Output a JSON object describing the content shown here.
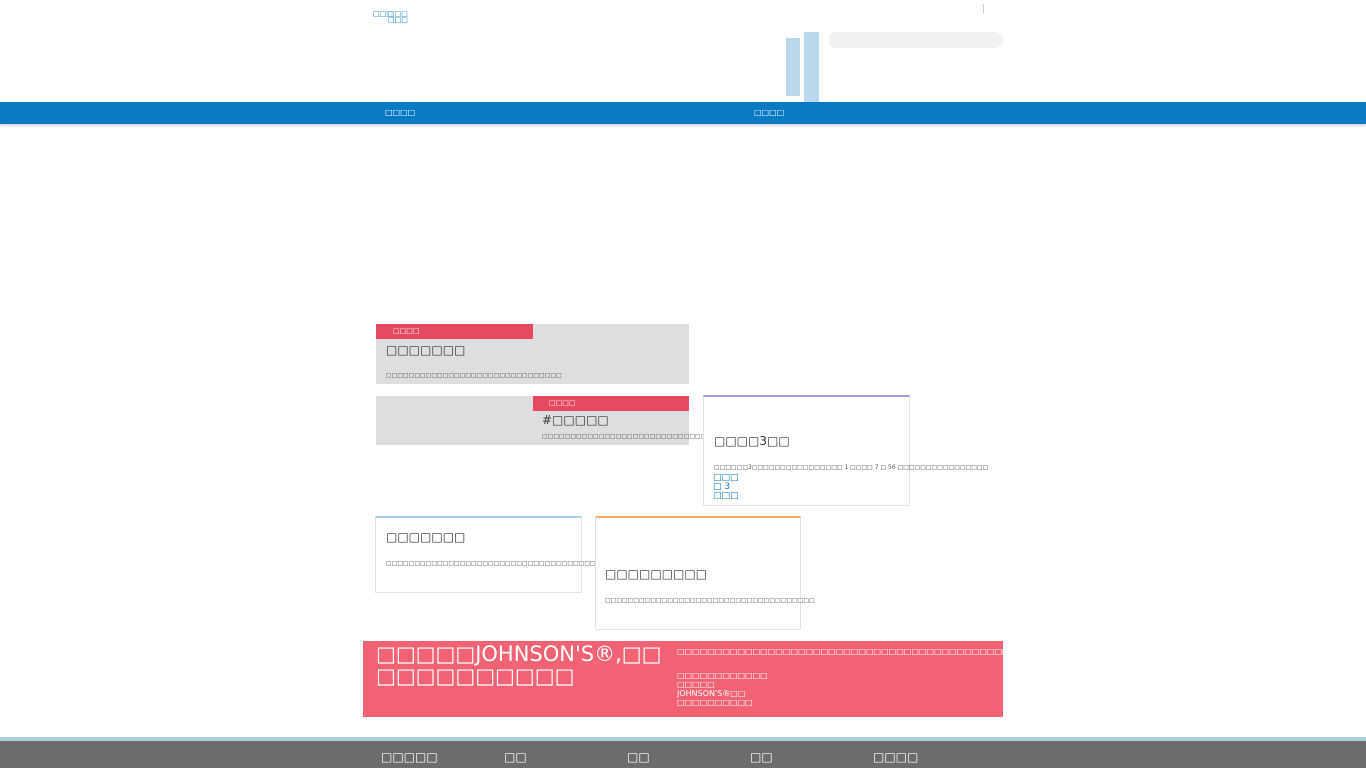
{
  "header": {
    "util_links": [
      "□□□",
      "□□□",
      "□□□"
    ],
    "search": {
      "placeholder": ""
    }
  },
  "nav": {
    "items": [
      "□□□□",
      "□□□□"
    ]
  },
  "cards": {
    "card1": {
      "tag": "□□□□",
      "title": "□□□□□□□",
      "desc": "□□□□□□□□□□□□□□□□□□□□□□□□□□□□□□□"
    },
    "card2": {
      "tag": "□□□□",
      "title": "#□□□□□",
      "desc": "□□□□□□□□□□□□□□□□□□□□□□□□□□□□□□□□□□□□□□"
    },
    "card3": {
      "title": "□□□□3□□",
      "desc": "□□□□□□3□□□□□□□□□□□□□□□□ 1 □□□□ 7 □ 56 □□□□□□□□□□□□□□□□",
      "links": [
        "□□□",
        "□ 3",
        "□□□"
      ]
    },
    "card4": {
      "title": "□□□□□□□",
      "desc": "□□□□□□□□□□□□□□□□□□□□□□□□□□□□□□□□□□□□□□□□□□□□□□□□"
    },
    "card5": {
      "title": "□□□□□□□□□",
      "desc": "□□□□□□□□□□□□□□□□□□□□□□□□□□□□□□□□□□□□□"
    }
  },
  "banner": {
    "title": "□□□□□JOHNSON'S®,□□□□□□□□□□□□",
    "text": "□□□□□□□□□□□□□□□□□□□□□□□□□□□□□□□□□□□□□□□□□□□□□□□□□□□□□□□□□□□□",
    "list": [
      "□□□□□□□□□□□□",
      "□□□□□",
      "JOHNSON'S®□□",
      "□□□□□□□□□□"
    ]
  },
  "footer": {
    "links": [
      "□□□□□",
      "□□",
      "□□",
      "□□",
      "□□□□"
    ]
  },
  "colors": {
    "nav_blue": "#0a7bc2",
    "tag_red": "#e64a61",
    "banner_pink": "#f06274",
    "footer_gray": "#6c6c6c",
    "card3_accent": "#a99be0",
    "card4_accent": "#a8cfe8",
    "card5_accent": "#f7b26a"
  }
}
